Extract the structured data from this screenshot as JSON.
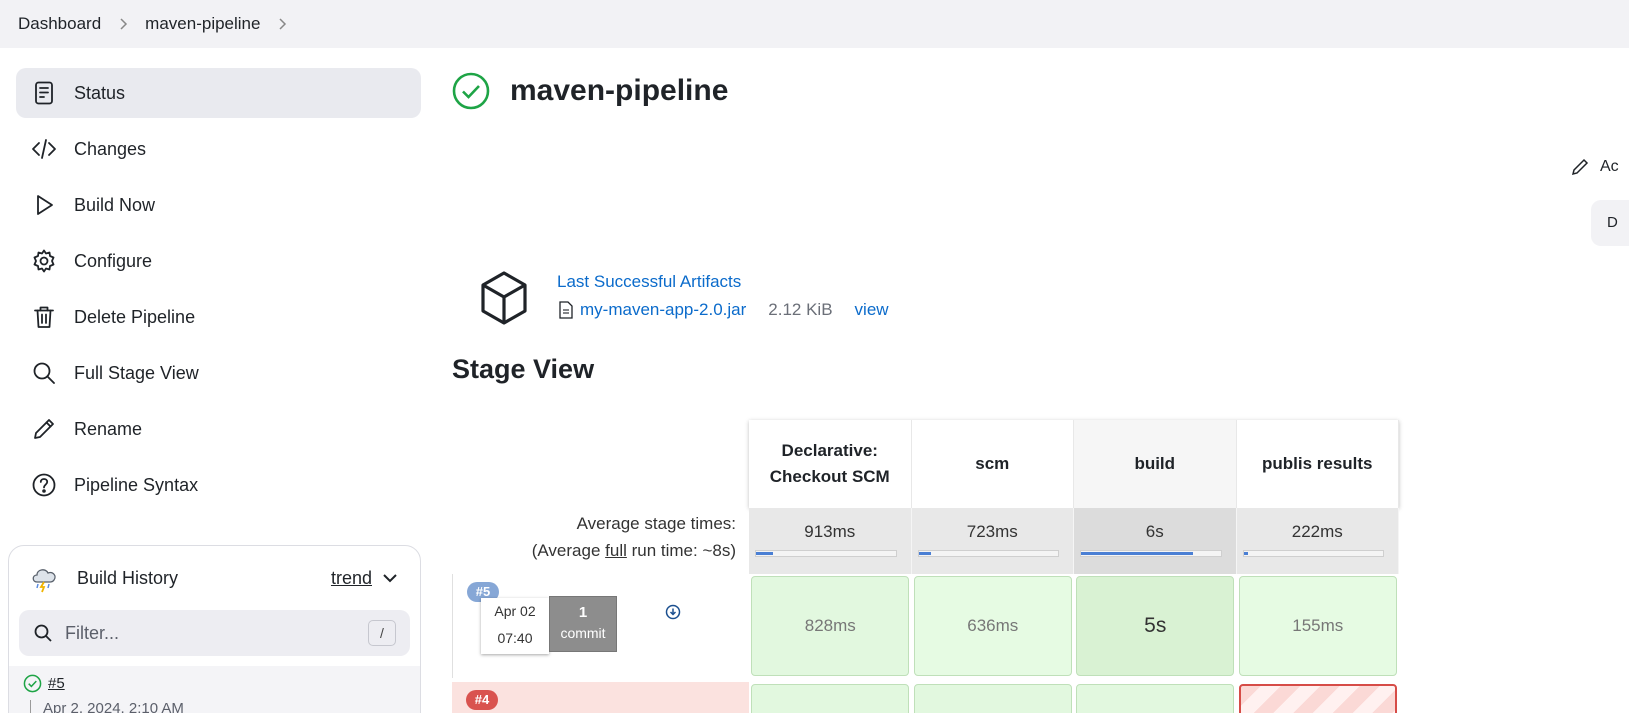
{
  "breadcrumb": {
    "items": [
      "Dashboard",
      "maven-pipeline"
    ]
  },
  "sidebar": {
    "items": [
      {
        "label": "Status",
        "icon": "document-icon",
        "active": true
      },
      {
        "label": "Changes",
        "icon": "code-icon"
      },
      {
        "label": "Build Now",
        "icon": "play-icon"
      },
      {
        "label": "Configure",
        "icon": "gear-icon"
      },
      {
        "label": "Delete Pipeline",
        "icon": "trash-icon"
      },
      {
        "label": "Full Stage View",
        "icon": "search-icon"
      },
      {
        "label": "Rename",
        "icon": "pencil-icon"
      },
      {
        "label": "Pipeline Syntax",
        "icon": "help-icon"
      }
    ]
  },
  "history": {
    "title": "Build History",
    "trend": "trend",
    "filter_placeholder": "Filter...",
    "shortcut": "/",
    "builds": [
      {
        "number": "#5",
        "date": "Apr 2, 2024, 2:10 AM",
        "status": "success"
      }
    ]
  },
  "main": {
    "title": "maven-pipeline",
    "side_action_label": "Ac",
    "side_button_label": "D",
    "artifacts": {
      "title": "Last Successful Artifacts",
      "file": "my-maven-app-2.0.jar",
      "size": "2.12 KiB",
      "view": "view"
    },
    "stage_view": {
      "heading": "Stage View",
      "avg_label_1": "Average stage times:",
      "avg_label_2_pre": "(Average ",
      "avg_label_2_link": "full",
      "avg_label_2_post": " run time: ~8s)",
      "stages": [
        "Declarative: Checkout SCM",
        "scm",
        "build",
        "publis results"
      ],
      "stage_line1": [
        "Declarative:",
        "scm",
        "build",
        "publis results"
      ],
      "stage_line2": [
        "Checkout SCM",
        "",
        "",
        ""
      ],
      "avg_times": [
        "913ms",
        "723ms",
        "6s",
        "222ms"
      ],
      "avg_fraction": [
        0.12,
        0.09,
        0.8,
        0.03
      ],
      "runs": [
        {
          "badge": "#5",
          "date": "Apr 02",
          "time": "07:40",
          "commits": "1",
          "commit_label": "commit",
          "durations": [
            "828ms",
            "636ms",
            "5s",
            "155ms"
          ],
          "status": "success"
        },
        {
          "badge": "#4",
          "status": "failed"
        }
      ]
    }
  },
  "colors": {
    "link": "#0b6bcb",
    "success": "#1ea446",
    "failure": "#d64c47",
    "stage_success": "#e2f8df",
    "progress": "#4a7fd4"
  }
}
